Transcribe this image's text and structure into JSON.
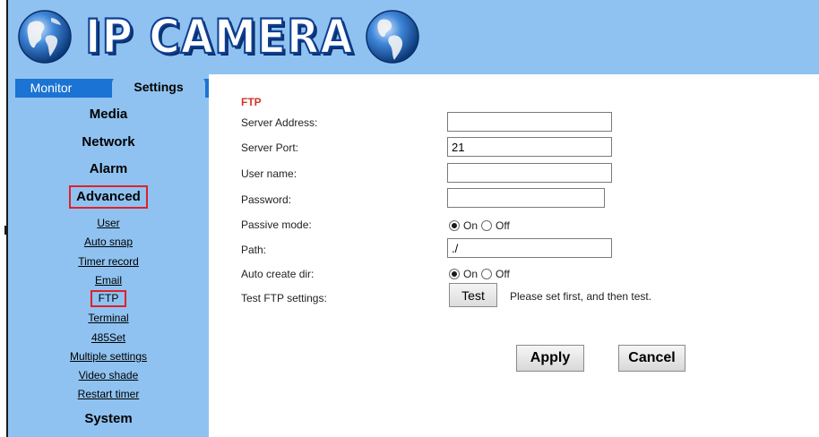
{
  "header": {
    "logo_text": "IP CAMERA"
  },
  "tabs": {
    "monitor": "Monitor",
    "settings": "Settings"
  },
  "nav": {
    "media": "Media",
    "network": "Network",
    "alarm": "Alarm",
    "advanced": "Advanced",
    "system": "System",
    "sub_items": {
      "user": "User",
      "auto_snap": "Auto snap",
      "timer_record": "Timer record",
      "email": "Email",
      "ftp": "FTP",
      "terminal": "Terminal",
      "set485": "485Set",
      "multiple_settings": "Multiple settings",
      "video_shade": "Video shade",
      "restart_timer": "Restart timer"
    },
    "active_category": "Advanced",
    "active_item": "FTP"
  },
  "form": {
    "title": "FTP",
    "server_address": {
      "label": "Server Address:",
      "value": ""
    },
    "server_port": {
      "label": "Server Port:",
      "value": "21"
    },
    "user_name": {
      "label": "User name:",
      "value": ""
    },
    "password": {
      "label": "Password:",
      "value": ""
    },
    "passive_mode": {
      "label": "Passive mode:",
      "on": "On",
      "off": "Off",
      "selected": "On"
    },
    "path": {
      "label": "Path:",
      "value": "./"
    },
    "auto_create_dir": {
      "label": "Auto create dir:",
      "on": "On",
      "off": "Off",
      "selected": "On"
    },
    "test_ftp": {
      "label": "Test FTP settings:",
      "button": "Test",
      "hint": "Please set first, and then test."
    }
  },
  "actions": {
    "apply": "Apply",
    "cancel": "Cancel"
  },
  "colors": {
    "panel_blue": "#8fc2f0",
    "tab_blue": "#1b73d3",
    "highlight_red": "#e0202a",
    "title_red": "#d6342a"
  },
  "icons": {
    "logo_left": "globe-americas-icon",
    "logo_right": "globe-americas-icon"
  }
}
